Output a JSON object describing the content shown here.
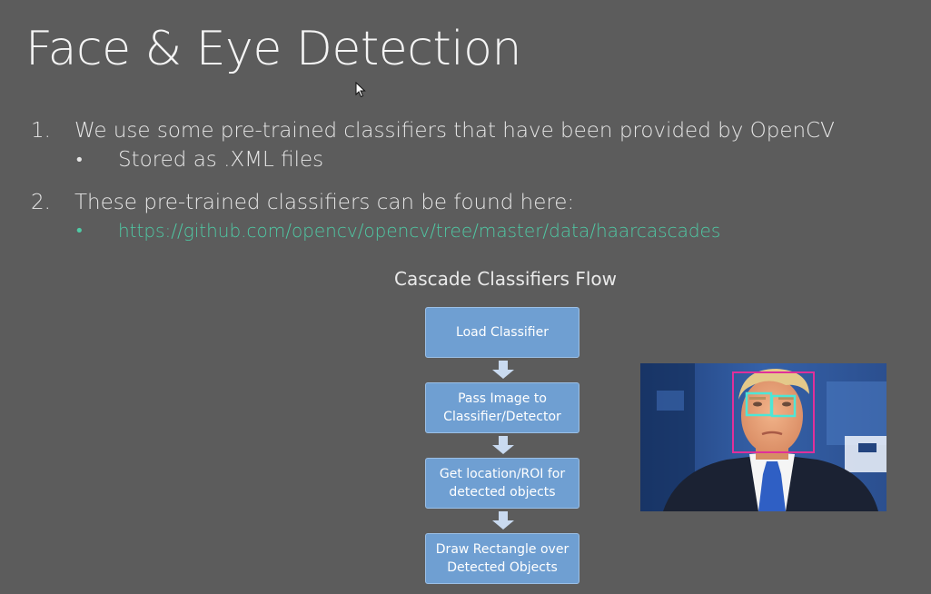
{
  "slide": {
    "title": "Face & Eye Detection",
    "items": [
      {
        "number": "1.",
        "text": "We use some pre-trained classifiers that have been provided by OpenCV",
        "sub": {
          "bullet": "•",
          "text": "Stored as .XML files"
        }
      },
      {
        "number": "2.",
        "text": "These pre-trained classifiers can be found here:",
        "sub": {
          "bullet": "•",
          "text": "https://github.com/opencv/opencv/tree/master/data/haarcascades"
        }
      }
    ]
  },
  "flow": {
    "title": "Cascade Classifiers Flow",
    "steps": [
      "Load Classifier",
      "Pass Image to Classifier/Detector",
      "Get location/ROI for detected objects",
      "Draw Rectangle over Detected Objects"
    ]
  },
  "colors": {
    "background": "#5c5c5c",
    "link": "#4fc9a4",
    "flow_box": "#6f9fd2",
    "face_box": "#e0309a",
    "eye_box": "#4ee6d6"
  },
  "image": {
    "face_detections": 1,
    "eye_detections": 2
  }
}
